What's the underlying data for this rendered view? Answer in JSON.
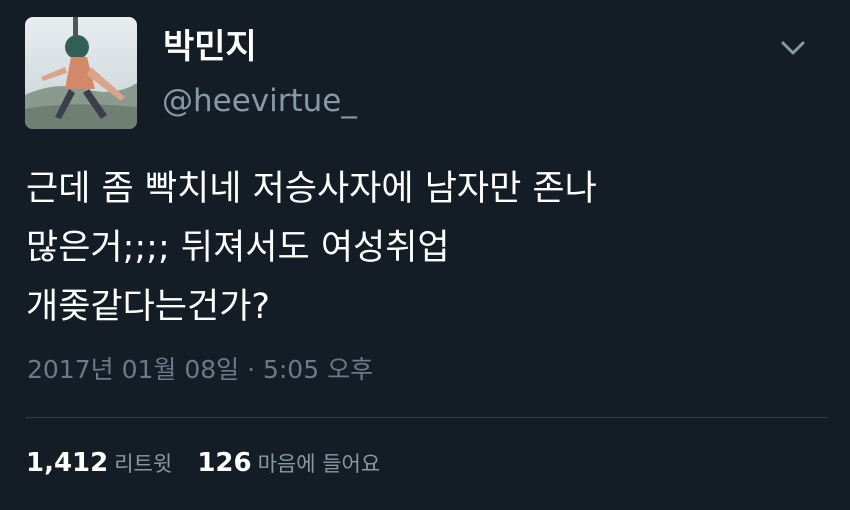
{
  "tweet": {
    "display_name": "박민지",
    "handle": "@heevirtue_",
    "text_lines": [
      "근데 좀 빡치네 저승사자에 남자만 존나",
      "많은거;;;; 뒤져서도 여성취업",
      "개좆같다는건가?"
    ],
    "timestamp": "2017년 01월 08일 · 5:05 오후",
    "retweets": {
      "count": "1,412",
      "label": "리트윗"
    },
    "likes": {
      "count": "126",
      "label": "마음에 들어요"
    }
  },
  "icons": {
    "avatar": "profile-photo",
    "menu": "chevron-down-icon"
  },
  "colors": {
    "background": "#141d26",
    "primary_text": "#ffffff",
    "secondary_text": "#8899a6",
    "divider": "#2f3e4c"
  }
}
